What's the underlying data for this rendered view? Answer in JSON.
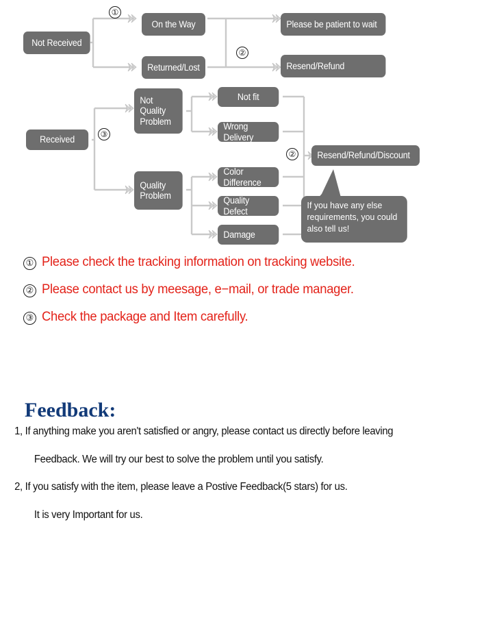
{
  "diagram": {
    "nodes": [
      {
        "id": "not-received",
        "label": "Not Received"
      },
      {
        "id": "on-the-way",
        "label": "On the Way"
      },
      {
        "id": "returned-lost",
        "label": "Returned/Lost"
      },
      {
        "id": "please-wait",
        "label": "Please be patient to wait"
      },
      {
        "id": "resend-refund",
        "label": "Resend/Refund"
      },
      {
        "id": "received",
        "label": "Received"
      },
      {
        "id": "not-quality-problem",
        "label": "Not\nQuality\nProblem"
      },
      {
        "id": "quality-problem",
        "label": "Quality\nProblem"
      },
      {
        "id": "not-fit",
        "label": "Not fit"
      },
      {
        "id": "wrong-delivery",
        "label": "Wrong Delivery"
      },
      {
        "id": "color-difference",
        "label": "Color Difference"
      },
      {
        "id": "quality-defect",
        "label": "Quality Defect"
      },
      {
        "id": "damage",
        "label": "Damage"
      },
      {
        "id": "resend-refund-discount",
        "label": "Resend/Refund/Discount"
      }
    ],
    "markers": [
      {
        "id": "marker-1-top",
        "label": "①"
      },
      {
        "id": "marker-2-top",
        "label": "②"
      },
      {
        "id": "marker-3-left",
        "label": "③"
      },
      {
        "id": "marker-2-bottom",
        "label": "②"
      }
    ],
    "callout": {
      "text": "If you have any else requirements, you could also tell us!"
    },
    "colors": {
      "node_fill": "#6e6e6e",
      "node_text": "#ffffff",
      "connector": "#c9c9c9"
    }
  },
  "notes": {
    "items": [
      {
        "marker": "①",
        "text": "Please check the tracking information on tracking website."
      },
      {
        "marker": "②",
        "text": "Please contact us by meesage, e−mail, or trade manager."
      },
      {
        "marker": "③",
        "text": "Check the package and Item carefully."
      }
    ],
    "color": "#e32219"
  },
  "feedback": {
    "title": "Feedback:",
    "title_color": "#123a78",
    "lines": [
      {
        "indent": false,
        "text": "1, If anything make you aren't satisfied or angry, please contact us directly before leaving"
      },
      {
        "indent": true,
        "text": "Feedback. We will try our best to solve the problem until you satisfy."
      },
      {
        "indent": false,
        "text": "2, If you satisfy with the item, please leave a Postive Feedback(5 stars) for us."
      },
      {
        "indent": true,
        "text": "It is very Important for us."
      }
    ]
  }
}
